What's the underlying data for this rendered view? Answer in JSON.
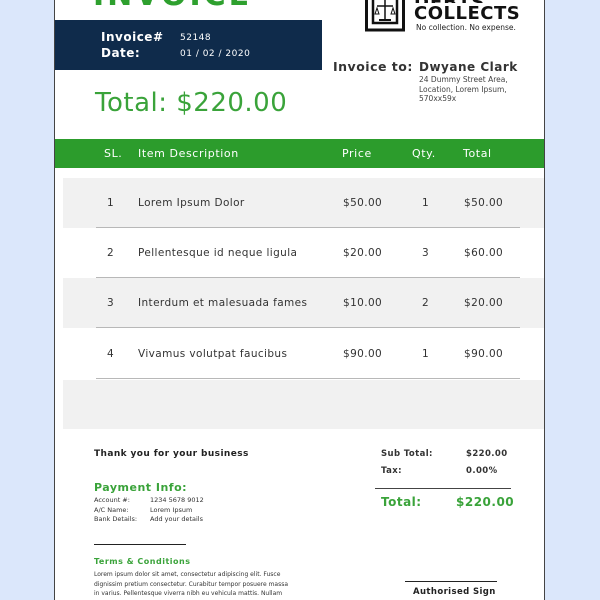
{
  "document": {
    "title": "INVOICE",
    "brand": {
      "name_top": "DEBTS",
      "name": "COLLECTS",
      "tagline": "No collection. No expense."
    },
    "invoice_meta": {
      "number_label": "Invoice#",
      "number": "52148",
      "date_label": "Date:",
      "date": "01 / 02 / 2020"
    },
    "total_banner": "Total: $220.00",
    "bill_to": {
      "label": "Invoice to:",
      "name": "Dwyane Clark",
      "address": "24 Dummy Street Area, Location, Lorem Ipsum, 570xx59x"
    },
    "table": {
      "headers": [
        "SL.",
        "Item Description",
        "Price",
        "Qty.",
        "Total"
      ],
      "rows": [
        {
          "sl": "1",
          "description": "Lorem Ipsum Dolor",
          "price": "$50.00",
          "qty": "1",
          "total": "$50.00"
        },
        {
          "sl": "2",
          "description": "Pellentesque id neque ligula",
          "price": "$20.00",
          "qty": "3",
          "total": "$60.00"
        },
        {
          "sl": "3",
          "description": "Interdum et malesuada fames",
          "price": "$10.00",
          "qty": "2",
          "total": "$20.00"
        },
        {
          "sl": "4",
          "description": "Vivamus volutpat faucibus",
          "price": "$90.00",
          "qty": "1",
          "total": "$90.00"
        }
      ]
    },
    "thanks": "Thank you for your business",
    "payment": {
      "title": "Payment Info:",
      "account_label": "Account #:",
      "account": "1234 5678 9012",
      "name_label": "A/C Name:",
      "name": "Lorem Ipsum",
      "bank_label": "Bank Details:",
      "bank": "Add your details"
    },
    "summary": {
      "subtotal_label": "Sub Total:",
      "subtotal": "$220.00",
      "tax_label": "Tax:",
      "tax": "0.00%",
      "total_label": "Total:",
      "total": "$220.00"
    },
    "terms": {
      "title": "Terms & Conditions",
      "text": "Lorem ipsum dolor sit amet, consectetur adipiscing elit. Fusce dignissim pretium consectetur. Curabitur tempor posuere massa in varius. Pellentesque viverra nibh eu vehicula mattis. Nullam porta"
    },
    "signature": "Authorised Sign"
  },
  "colors": {
    "accent_green": "#2c9c2c",
    "navy": "#0f2b4b",
    "background": "#dbe7fb"
  }
}
